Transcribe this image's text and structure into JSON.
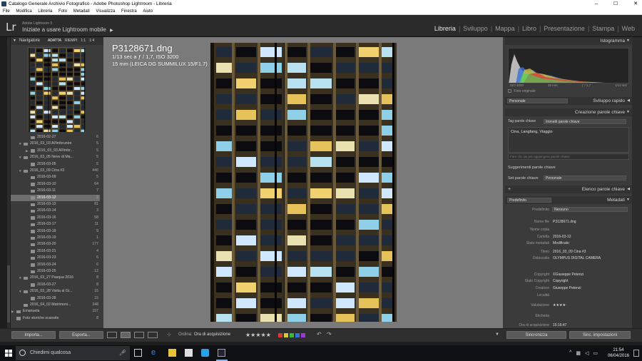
{
  "window": {
    "title": "Catalogo Generale Archivio Fotografico - Adobe Photoshop Lightroom - Libreria",
    "controls": [
      "–",
      "☐",
      "✕"
    ]
  },
  "menu": [
    "File",
    "Modifica",
    "Libreria",
    "Foto",
    "Metadati",
    "Visualizza",
    "Finestra",
    "Aiuto"
  ],
  "identity": {
    "logo": "Lr",
    "version": "Adobe Lightroom 5",
    "subtitle": "Iniziate a usare Lightroom mobile",
    "arrow": "▶"
  },
  "modules": [
    {
      "label": "Libreria",
      "active": true
    },
    {
      "label": "Sviluppo",
      "active": false
    },
    {
      "label": "Mappa",
      "active": false
    },
    {
      "label": "Libro",
      "active": false
    },
    {
      "label": "Presentazione",
      "active": false
    },
    {
      "label": "Stampa",
      "active": false
    },
    {
      "label": "Web",
      "active": false
    }
  ],
  "navigator": {
    "title": "Navigatore",
    "zoom": [
      "ADATTA",
      "RIEMPI",
      "1:1",
      "1:4"
    ]
  },
  "folders": [
    {
      "name": "2016-02-27",
      "count": "6",
      "level": 2,
      "arrow": ""
    },
    {
      "name": "2016_03_03 All'imbrunire",
      "count": "5",
      "level": 1,
      "arrow": "▼"
    },
    {
      "name": "2016_03_03 All'imbr...",
      "count": "5",
      "level": 2,
      "arrow": "▶"
    },
    {
      "name": "2016_03_05 Neve di Ma...",
      "count": "5",
      "level": 1,
      "arrow": "▼"
    },
    {
      "name": "2016-03-05",
      "count": "5",
      "level": 2,
      "arrow": ""
    },
    {
      "name": "2016_03_09 Cina #3",
      "count": "446",
      "level": 1,
      "arrow": "▼"
    },
    {
      "name": "2016-03-09",
      "count": "5",
      "level": 2,
      "arrow": ""
    },
    {
      "name": "2016-03-10",
      "count": "64",
      "level": 2,
      "arrow": ""
    },
    {
      "name": "2016-03-11",
      "count": "7",
      "level": 2,
      "arrow": ""
    },
    {
      "name": "2016-03-12",
      "count": "2",
      "level": 2,
      "arrow": "",
      "selected": true
    },
    {
      "name": "2016-03-13",
      "count": "81",
      "level": 2,
      "arrow": ""
    },
    {
      "name": "2016-03-14",
      "count": "3",
      "level": 2,
      "arrow": ""
    },
    {
      "name": "2016-03-16",
      "count": "58",
      "level": 2,
      "arrow": ""
    },
    {
      "name": "2016-03-17",
      "count": "11",
      "level": 2,
      "arrow": ""
    },
    {
      "name": "2016-03-18",
      "count": "9",
      "level": 2,
      "arrow": ""
    },
    {
      "name": "2016-03-19",
      "count": "1",
      "level": 2,
      "arrow": ""
    },
    {
      "name": "2016-03-20",
      "count": "177",
      "level": 2,
      "arrow": ""
    },
    {
      "name": "2016-03-21",
      "count": "4",
      "level": 2,
      "arrow": ""
    },
    {
      "name": "2016-03-23",
      "count": "6",
      "level": 2,
      "arrow": ""
    },
    {
      "name": "2016-03-24",
      "count": "6",
      "level": 2,
      "arrow": ""
    },
    {
      "name": "2016-03-25",
      "count": "12",
      "level": 2,
      "arrow": ""
    },
    {
      "name": "2016_03_27 Pasqua 2016",
      "count": "8",
      "level": 1,
      "arrow": "▼"
    },
    {
      "name": "2016-03-27",
      "count": "8",
      "level": 2,
      "arrow": ""
    },
    {
      "name": "2016_03_28 Visita al Gi...",
      "count": "15",
      "level": 1,
      "arrow": "▼"
    },
    {
      "name": "2016-03-28",
      "count": "15",
      "level": 2,
      "arrow": ""
    },
    {
      "name": "2016_04_02 Matrimoni...",
      "count": "348",
      "level": 1,
      "arrow": ""
    },
    {
      "name": "Emanuela",
      "count": "157",
      "level": 0,
      "arrow": "▶"
    },
    {
      "name": "Foto storiche scansite",
      "count": "8",
      "level": 0,
      "arrow": ""
    }
  ],
  "photo": {
    "filename": "P3128671.dng",
    "exposure": "1/13 sec a ƒ / 1,7, ISO 3200",
    "lens": "15 mm (LEICA DG SUMMILUX 15/F1.7)"
  },
  "right": {
    "histogram": {
      "title": "Istogramma",
      "iso": "ISO 3200",
      "focal": "15 mm",
      "aperture": "ƒ / 1,7",
      "shutter": "1/13 sec",
      "original": "Foto originale"
    },
    "quick": {
      "preset": "Personale",
      "title": "Sviluppo rapido"
    },
    "keywording": {
      "title": "Creazione parole chiave",
      "tag_label": "Tag parole chiave",
      "tag_mode": "Immetti parole chiave",
      "keywords": "Cina, Langfang, Viaggio",
      "hint": "Fare clic qui per aggiungere parole chiave",
      "suggestions": "Suggerimenti parole chiave",
      "set_label": "Set parole chiave",
      "set_value": "Personale"
    },
    "keyword_list": {
      "plus": "+",
      "title": "Elenco parole chiave"
    },
    "metadata": {
      "preset_left": "Predefinito",
      "title": "Metadati",
      "preset_label": "Predefinito",
      "preset_value": "Nessuno",
      "rows": [
        {
          "label": "Nome file",
          "value": "P3128671.dng"
        },
        {
          "label": "Nome copia",
          "value": ""
        },
        {
          "label": "Cartella",
          "value": "2016-03-12"
        },
        {
          "label": "Stato metadati",
          "value": "Modificato"
        },
        {
          "label": "Titolo",
          "value": "2016_03_09 Cina #3"
        },
        {
          "label": "Didascalia",
          "value": "OLYMPUS DIGITAL CAMERA"
        },
        {
          "label": "Copyright",
          "value": "©Giuseppe Petenzi"
        },
        {
          "label": "Stato Copyright",
          "value": "Copyright"
        },
        {
          "label": "Creatore",
          "value": "Giuseppe Petenzi"
        },
        {
          "label": "Località",
          "value": ""
        },
        {
          "label": "Valutazione",
          "value": "★★★★·"
        },
        {
          "label": "Etichetta",
          "value": ""
        },
        {
          "label": "Ora di acquisizione",
          "value": "15:16:47"
        }
      ]
    }
  },
  "bottom": {
    "import": "Importa...",
    "export": "Esporta...",
    "order_label": "Ordina:",
    "order_value": "Ora di acquisizione",
    "stars": "★★★★★",
    "sync": "Sincronizza",
    "sync_settings": "Sinc. impostazioni"
  },
  "taskbar": {
    "search": "Chiedimi qualcosa",
    "time": "21:54",
    "date": "06/04/2016"
  }
}
